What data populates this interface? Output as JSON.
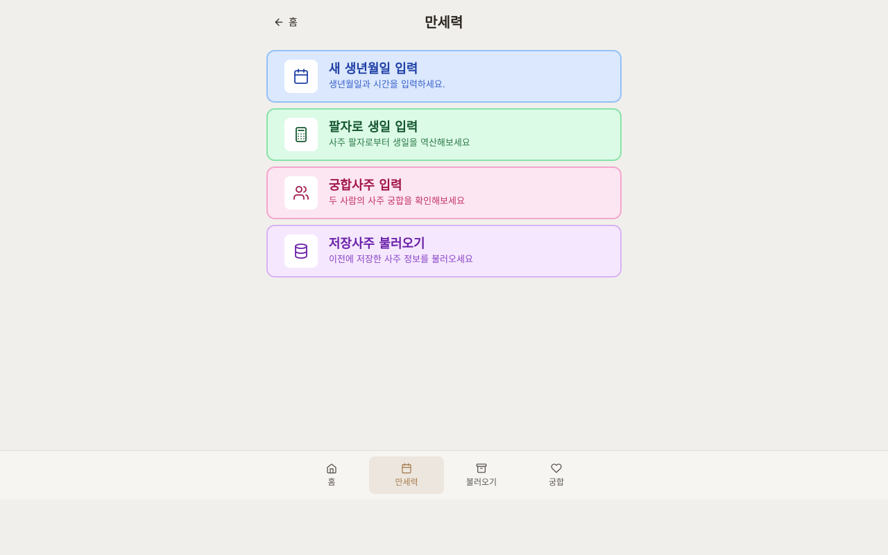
{
  "header": {
    "back_label": "홈",
    "title": "만세력"
  },
  "menu": [
    {
      "title": "새 생년월일 입력",
      "desc": "생년월일과 시간을 입력하세요.",
      "icon": "calendar-icon",
      "color": "#1e3fa5"
    },
    {
      "title": "팔자로 생일 입력",
      "desc": "사주 팔자로부터 생일을 역산해보세요",
      "icon": "calculator-icon",
      "color": "#13552e"
    },
    {
      "title": "궁합사주 입력",
      "desc": "두 사람의 사주 궁합을 확인해보세요",
      "icon": "users-icon",
      "color": "#a01449"
    },
    {
      "title": "저장사주 불러오기",
      "desc": "이전에 저장한 사주 정보를 불러오세요",
      "icon": "database-icon",
      "color": "#6a1fa8"
    }
  ],
  "nav": [
    {
      "label": "홈",
      "icon": "home-icon"
    },
    {
      "label": "만세력",
      "icon": "calendar-icon",
      "active": true
    },
    {
      "label": "불러오기",
      "icon": "archive-icon"
    },
    {
      "label": "궁합",
      "icon": "heart-icon"
    }
  ]
}
